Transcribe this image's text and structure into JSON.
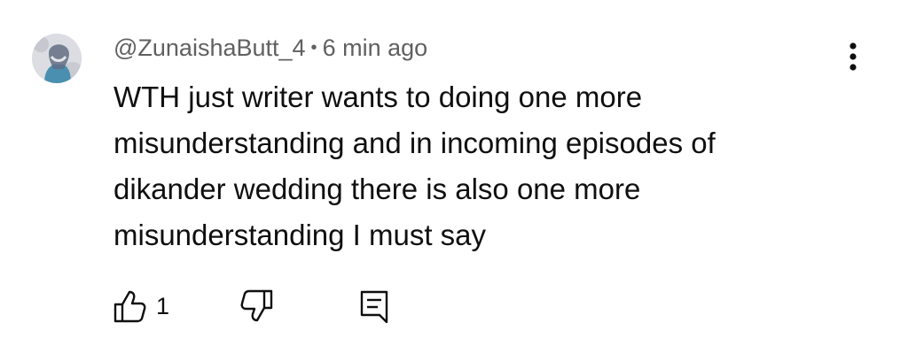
{
  "comment": {
    "author": "@ZunaishaButt_4",
    "separator": "•",
    "time": "6 min ago",
    "text_lines": [
      "WTH just writer wants to doing one more",
      "misunderstanding and in incoming episodes of",
      "dikander wedding there is also one more",
      "misunderstanding I must say"
    ],
    "like_count": "1"
  },
  "icons": {
    "avatar": "avatar",
    "menu": "more-vert-icon",
    "like": "thumb-up-icon",
    "dislike": "thumb-down-icon",
    "reply": "reply-comment-icon"
  },
  "colors": {
    "text": "#0f0f0f",
    "meta": "#606060",
    "avatar_bg": "#e7e7ea",
    "avatar_accent": "#4b8fb0"
  }
}
